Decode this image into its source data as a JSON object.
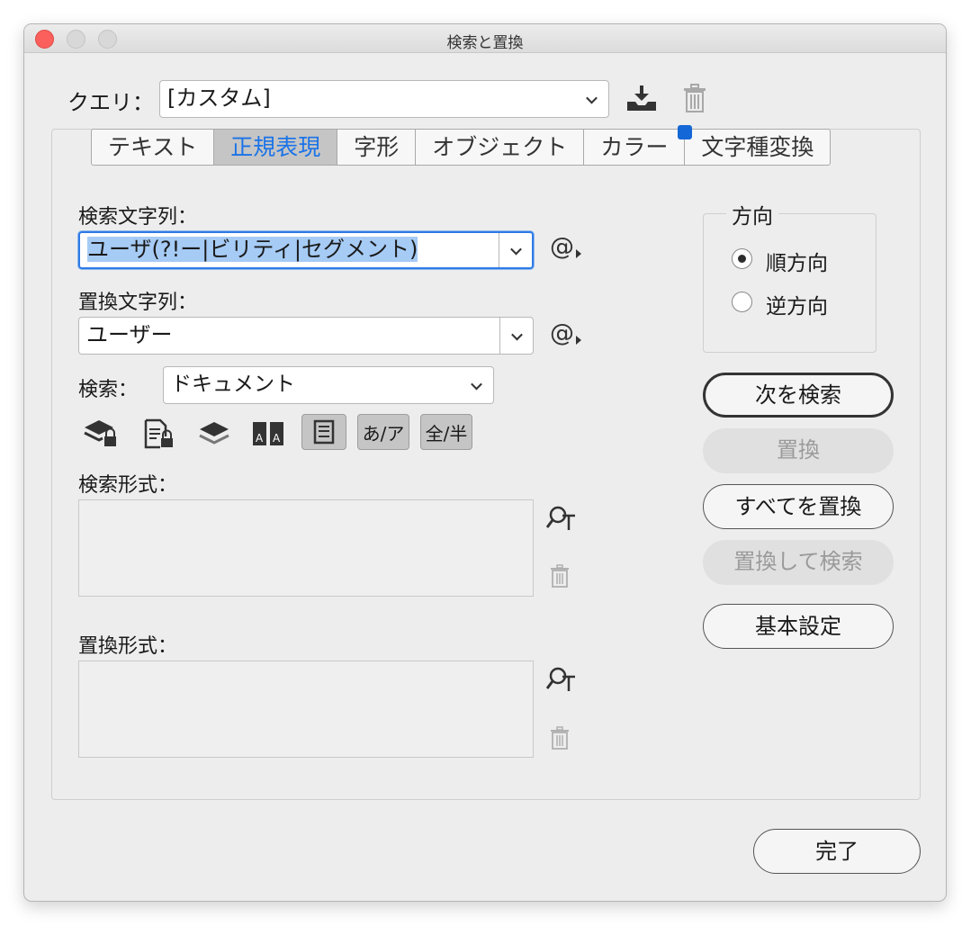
{
  "window": {
    "title": "検索と置換"
  },
  "query": {
    "label": "クエリ：",
    "value": "[カスタム]"
  },
  "tabs": [
    {
      "label": "テキスト",
      "active": false
    },
    {
      "label": "正規表現",
      "active": true
    },
    {
      "label": "字形",
      "active": false
    },
    {
      "label": "オブジェクト",
      "active": false
    },
    {
      "label": "カラー",
      "active": false
    },
    {
      "label": "文字種変換",
      "active": false
    }
  ],
  "find": {
    "label": "検索文字列：",
    "value": "ユーザ(?!ー|ビリティ|セグメント)"
  },
  "replace": {
    "label": "置換文字列：",
    "value": "ユーザー"
  },
  "search": {
    "label": "検索：",
    "value": "ドキュメント"
  },
  "options": {
    "kana_label": "あ/ア",
    "width_label": "全/半"
  },
  "find_format": {
    "label": "検索形式："
  },
  "replace_format": {
    "label": "置換形式："
  },
  "direction": {
    "label": "方向",
    "forward": "順方向",
    "backward": "逆方向"
  },
  "buttons": {
    "find_next": "次を検索",
    "change": "置換",
    "change_all": "すべてを置換",
    "change_find": "置換して検索",
    "more_options": "基本設定",
    "done": "完了"
  },
  "colors": {
    "accent": "#1a73e8",
    "selection": "#a6cbf5",
    "tab_badge": "#1467d6"
  }
}
